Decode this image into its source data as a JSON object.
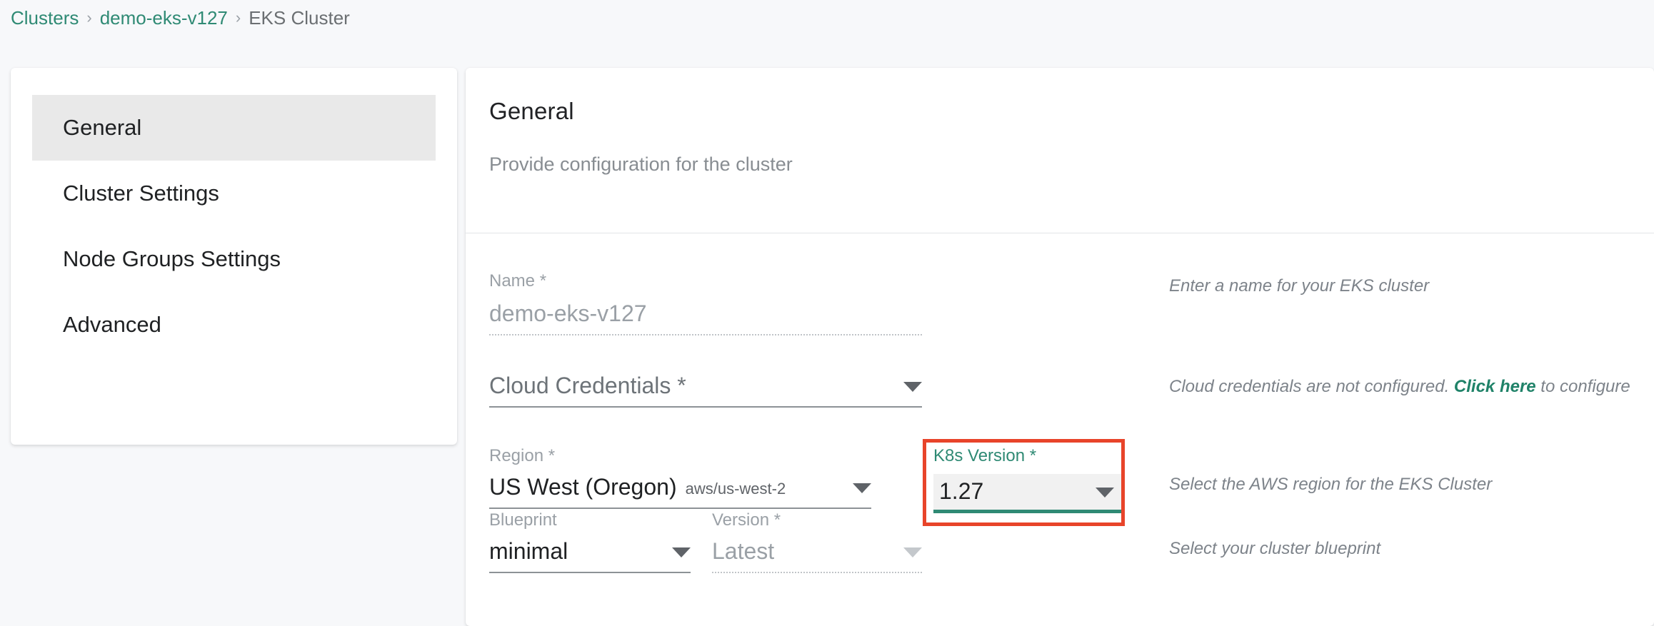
{
  "breadcrumb": {
    "items": [
      {
        "label": "Clusters",
        "type": "link"
      },
      {
        "label": "demo-eks-v127",
        "type": "link"
      },
      {
        "label": "EKS Cluster",
        "type": "current"
      }
    ],
    "separator": "›"
  },
  "sidebar": {
    "items": [
      {
        "label": "General",
        "active": true
      },
      {
        "label": "Cluster Settings",
        "active": false
      },
      {
        "label": "Node Groups Settings",
        "active": false
      },
      {
        "label": "Advanced",
        "active": false
      }
    ]
  },
  "panel": {
    "title": "General",
    "subtitle": "Provide configuration for the cluster"
  },
  "form": {
    "name": {
      "label": "Name *",
      "value": "demo-eks-v127",
      "state": "disabled"
    },
    "cloud_credentials": {
      "label": "Cloud Credentials *",
      "value": "",
      "placeholder": "Cloud Credentials *",
      "state": "empty"
    },
    "region": {
      "label": "Region *",
      "value": "US West (Oregon)",
      "sub_value": "aws/us-west-2",
      "state": "active"
    },
    "k8s_version": {
      "label": "K8s Version *",
      "value": "1.27",
      "state": "focused",
      "highlighted": true
    },
    "blueprint": {
      "label": "Blueprint",
      "value": "minimal",
      "state": "active"
    },
    "blueprint_version": {
      "label": "Version *",
      "value": "Latest",
      "state": "disabled"
    }
  },
  "hints": {
    "name": "Enter a name for your EKS cluster",
    "cloud_credentials_prefix": "Cloud credentials are not configured. ",
    "cloud_credentials_link": "Click here",
    "cloud_credentials_suffix": " to configure",
    "region": "Select the AWS region for the EKS Cluster",
    "blueprint": "Select your cluster blueprint"
  },
  "colors": {
    "accent_teal": "#2f8a74",
    "link_teal": "#1f8268",
    "highlight_red": "#e8442a",
    "page_bg": "#f7f8fa",
    "nav_active_bg": "#e9e9e9"
  },
  "icons": {
    "chevron_down": "chevron-down-icon",
    "breadcrumb_separator": "chevron-right-icon"
  }
}
